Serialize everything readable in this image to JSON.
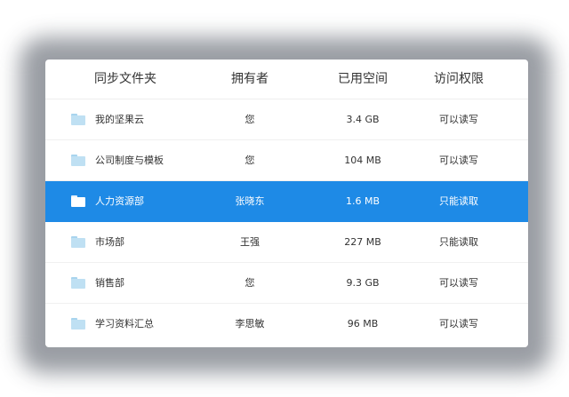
{
  "table": {
    "columns": {
      "name": "同步文件夹",
      "owner": "拥有者",
      "used": "已用空间",
      "permission": "访问权限"
    },
    "rows": [
      {
        "name": "我的坚果云",
        "owner": "您",
        "used": "3.4 GB",
        "permission": "可以读写",
        "icon": "folder-icon"
      },
      {
        "name": "公司制度与模板",
        "owner": "您",
        "used": "104 MB",
        "permission": "可以读写",
        "icon": "folder-icon"
      },
      {
        "name": "人力资源部",
        "owner": "张晓东",
        "used": "1.6 MB",
        "permission": "只能读取",
        "icon": "folder-icon",
        "selected": true
      },
      {
        "name": "市场部",
        "owner": "王强",
        "used": "227 MB",
        "permission": "只能读取",
        "icon": "folder-icon"
      },
      {
        "name": "销售部",
        "owner": "您",
        "used": "9.3 GB",
        "permission": "可以读写",
        "icon": "folder-icon"
      },
      {
        "name": "学习资料汇总",
        "owner": "李思敏",
        "used": "96 MB",
        "permission": "可以读写",
        "icon": "folder-icon"
      }
    ]
  },
  "colors": {
    "selected_row": "#1e8ae6",
    "folder": "#bfe0f3",
    "text": "#333333"
  }
}
